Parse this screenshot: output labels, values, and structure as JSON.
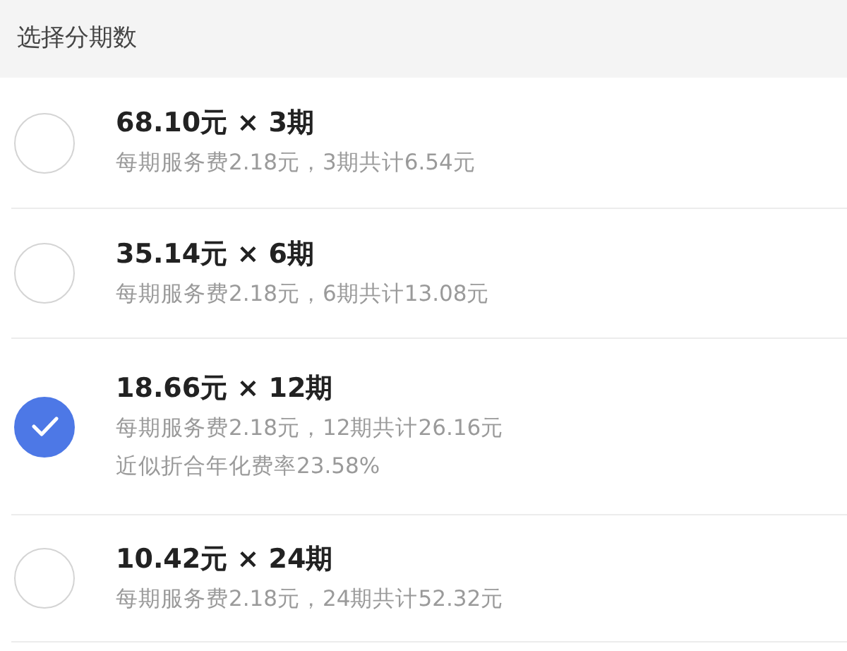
{
  "header": {
    "title": "选择分期数"
  },
  "options": [
    {
      "title": "68.10元 × 3期",
      "details": [
        "每期服务费2.18元，3期共计6.54元"
      ],
      "selected": false
    },
    {
      "title": "35.14元 × 6期",
      "details": [
        "每期服务费2.18元，6期共计13.08元"
      ],
      "selected": false
    },
    {
      "title": "18.66元 × 12期",
      "details": [
        "每期服务费2.18元，12期共计26.16元",
        "近似折合年化费率23.58%"
      ],
      "selected": true
    },
    {
      "title": "10.42元 × 24期",
      "details": [
        "每期服务费2.18元，24期共计52.32元"
      ],
      "selected": false
    }
  ]
}
